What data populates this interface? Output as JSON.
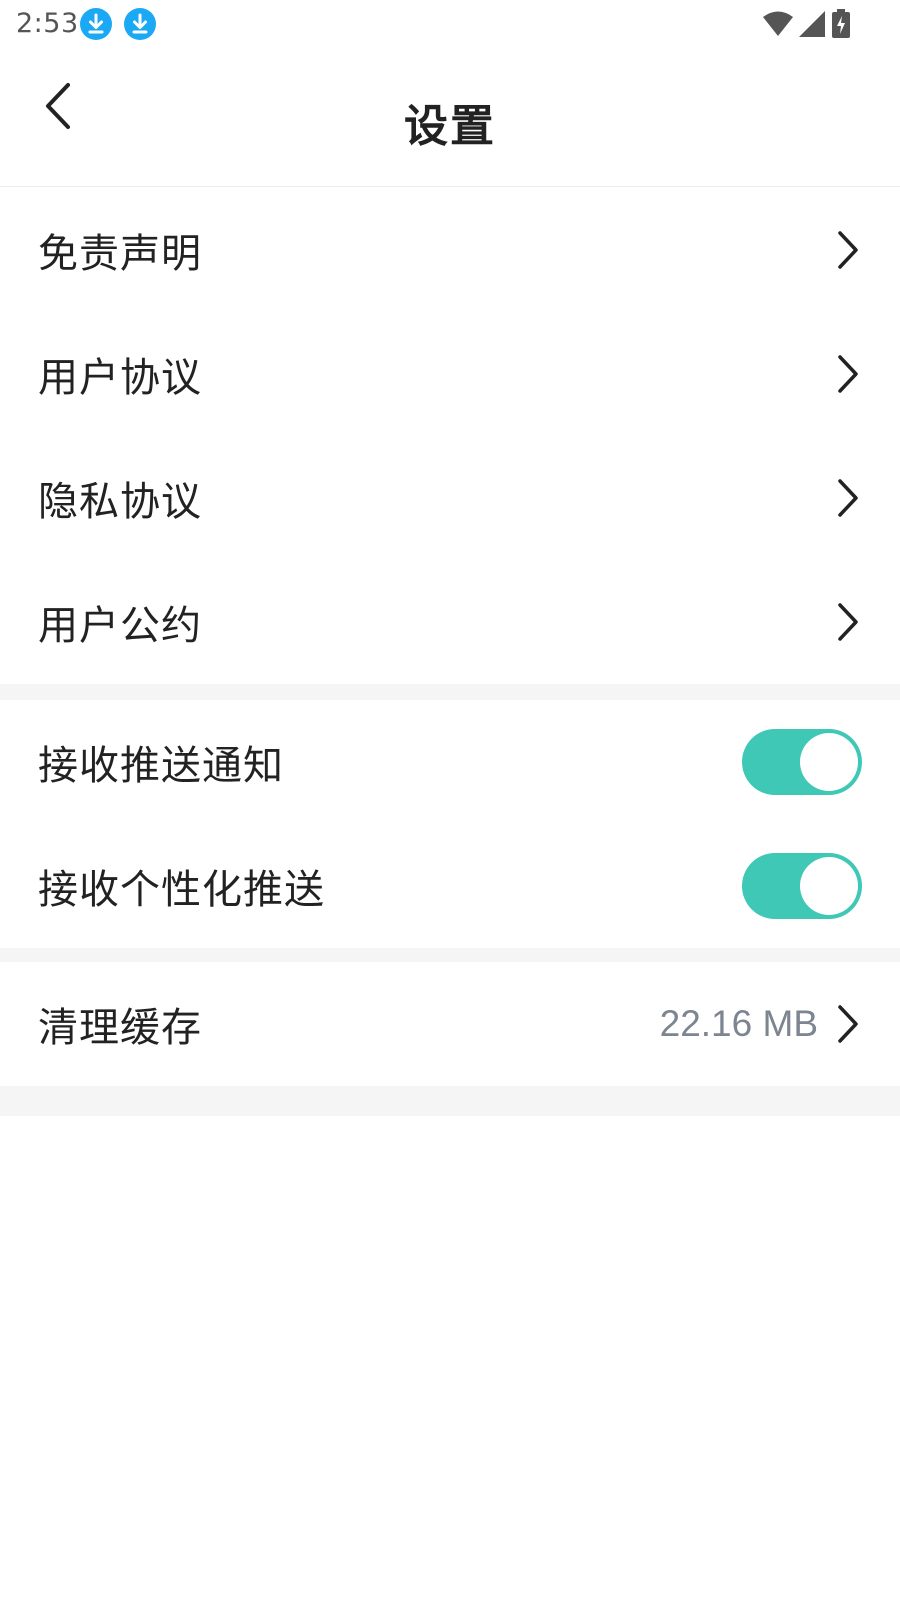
{
  "status_bar": {
    "time": "2:53",
    "icons": [
      "download-icon",
      "download-icon",
      "wifi-icon",
      "signal-icon",
      "battery-charging-icon"
    ]
  },
  "header": {
    "title": "设置",
    "back_icon": "chevron-left-icon"
  },
  "links": [
    {
      "label": "免责声明"
    },
    {
      "label": "用户协议"
    },
    {
      "label": "隐私协议"
    },
    {
      "label": "用户公约"
    }
  ],
  "toggles": [
    {
      "label": "接收推送通知",
      "on": true
    },
    {
      "label": "接收个性化推送",
      "on": true
    }
  ],
  "cache": {
    "label": "清理缓存",
    "value": "22.16 MB"
  },
  "colors": {
    "accent": "#3fc8b5",
    "download_badge": "#1ba9f5",
    "section_gap": "#f5f5f5",
    "secondary_text": "#7d8590"
  }
}
